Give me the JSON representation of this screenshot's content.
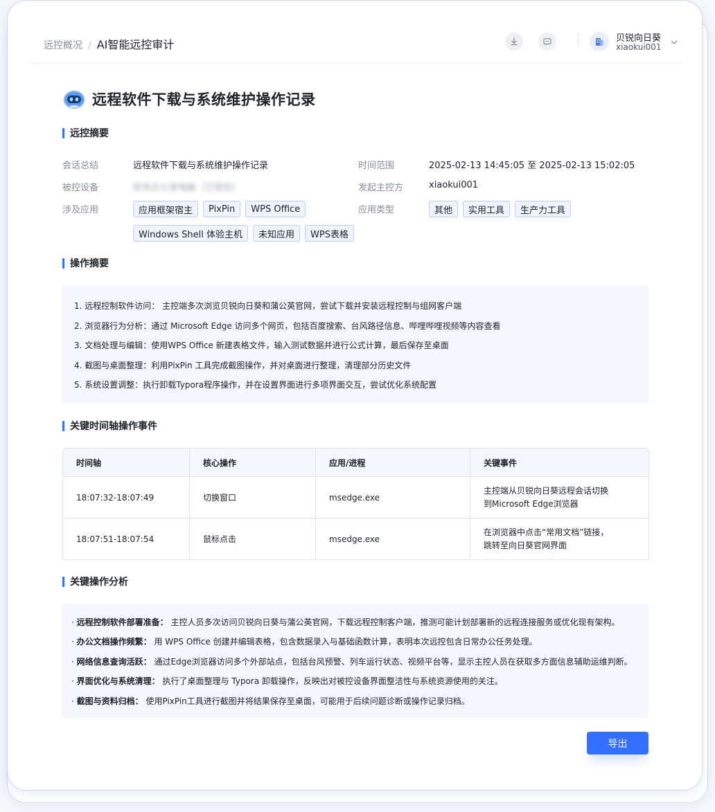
{
  "header": {
    "breadcrumb_root": "远控概况",
    "breadcrumb_sep": "/",
    "breadcrumb_current": "AI智能远控审计",
    "user_name": "贝锐向日葵",
    "user_id": "xiaokui001",
    "icons": [
      "download-icon",
      "message-icon",
      "building-icon",
      "chevron-down-icon"
    ]
  },
  "page_title": "远程软件下载与系统维护操作记录",
  "sections": {
    "summary": "远控摘要",
    "operations": "操作摘要",
    "timeline": "关键时间轴操作事件",
    "analysis": "关键操作分析"
  },
  "summary": {
    "session_label": "会话总结",
    "session_value": "远程软件下载与系统维护操作记录",
    "time_label": "时间范围",
    "time_value": "2025-02-13 14:45:05 至 2025-02-13 15:02:05",
    "device_label": "被控设备",
    "device_value": "财务办公室电脑（已受控）",
    "initiator_label": "发起主控方",
    "initiator_value": "xiaokui001",
    "apps_label": "涉及应用",
    "apps": [
      "应用框架宿主",
      "PixPin",
      "WPS Office",
      "Windows Shell 体验主机",
      "未知应用",
      "WPS表格"
    ],
    "types_label": "应用类型",
    "types": [
      "其他",
      "实用工具",
      "生产力工具"
    ]
  },
  "operations": [
    "1. 远程控制软件访问： 主控端多次浏览贝锐向日葵和蒲公英官网，尝试下载并安装远程控制与组网客户端",
    "2. 浏览器行为分析：通过 Microsoft Edge 访问多个网页，包括百度搜索、台风路径信息、哔哩哔哩视频等内容查看",
    "3. 文档处理与编辑：使用WPS Office 新建表格文件，输入测试数据并进行公式计算，最后保存至桌面",
    "4. 截图与桌面整理：利用PixPin 工具完成截图操作，并对桌面进行整理，清理部分历史文件",
    "5. 系统设置调整：执行卸载Typora程序操作，并在设置界面进行多项界面交互，尝试优化系统配置"
  ],
  "table": {
    "headers": [
      "时间轴",
      "核心操作",
      "应用/进程",
      "关键事件"
    ],
    "rows": [
      [
        "18:07:32-18:07:49",
        "切换窗口",
        "msedge.exe",
        "主控端从贝锐向日葵远程会话切换\n到Microsoft Edge浏览器"
      ],
      [
        "18:07:51-18:07:54",
        "鼠标点击",
        "msedge.exe",
        "在浏览器中点击“常用文档”链接，\n跳转至向日葵官网界面"
      ]
    ]
  },
  "analysis": [
    {
      "title": "远程控制软件部署准备：",
      "text": " 主控人员多次访问贝锐向日葵与蒲公英官网，下载远程控制客户端，推测可能计划部署新的远程连接服务或优化现有架构。"
    },
    {
      "title": "办公文档操作频繁：",
      "text": " 用 WPS Office 创建并编辑表格，包含数据录入与基础函数计算，表明本次远控包含日常办公任务处理。"
    },
    {
      "title": "网络信息查询活跃：",
      "text": " 通过Edge浏览器访问多个外部站点，包括台风预警、列车运行状态、视频平台等，显示主控人员在获取多方面信息辅助运维判断。"
    },
    {
      "title": "界面优化与系统清理：",
      "text": " 执行了桌面整理与 Typora 卸载操作，反映出对被控设备界面整洁性与系统资源使用的关注。"
    },
    {
      "title": "截图与资料归档：",
      "text": " 使用PixPin工具进行截图并将结果保存至桌面，可能用于后续问题诊断或操作记录归档。"
    }
  ],
  "export_label": "导出",
  "colors": {
    "accent": "#3370ff",
    "tag_bg": "#eef3fe",
    "tag_border": "#bccff5",
    "panel_bg": "#f4f7fc"
  }
}
